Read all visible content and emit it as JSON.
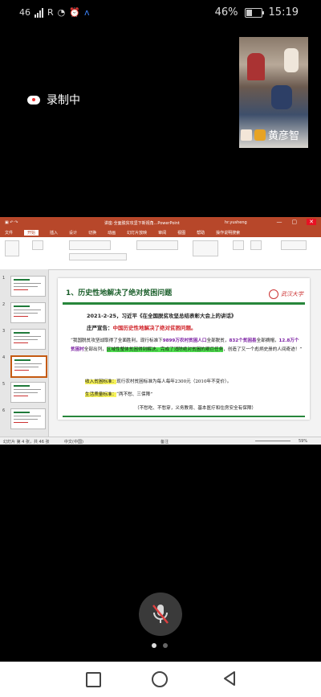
{
  "status_bar": {
    "network": "46",
    "signal2": "R",
    "battery": "46%",
    "battery_level": 0.46,
    "time": "15:19"
  },
  "recording": {
    "label": "录制中",
    "icon": "record-cloud-icon"
  },
  "participant": {
    "name": "黄彦智",
    "muted": true
  },
  "powerpoint": {
    "file_title": "讲座·全面脱贫攻坚下新视角...PowerPoint",
    "app": "PowerPoint",
    "user": "hr.yusheng",
    "tabs": [
      "文件",
      "开始",
      "插入",
      "设计",
      "切换",
      "动画",
      "幻灯片放映",
      "审阅",
      "视图",
      "帮助",
      "操作说明搜索"
    ],
    "active_tab": "开始",
    "slide_numbers": [
      "1",
      "2",
      "3",
      "4",
      "5",
      "6"
    ],
    "status_left": "幻灯片 第 4 张，共 46 张",
    "status_lang": "中文(中国)",
    "status_notes": "备注",
    "zoom": "59%"
  },
  "slide": {
    "heading": "1、历史性地解决了绝对贫困问题",
    "logo_text": "武汉大学",
    "date_line": "2021-2-25，习近平《在全国脱贫攻坚总结表彰大会上的讲话》",
    "declare_prefix": "庄严宣告：",
    "declare_red": "中国历史性地解决了绝对贫困问题。",
    "quote_1": "“我国脱贫攻坚战取得了全面胜利，现行标准下",
    "quote_purple_1": "9899万农村贫困人口",
    "quote_2": "全部脱贫，",
    "quote_purple_2": "832个贫困县",
    "quote_3": "全部摘帽，",
    "quote_purple_3": "12.8万个贫困村",
    "quote_4": "全部出列，",
    "quote_green": "区域性整体贫困得到解决，完成了消除绝对贫困的艰巨任务",
    "quote_5": "，创造了又一个彪炳史册的人间奇迹！”",
    "income_label": "收入贫困标准：",
    "income_text": "现行农村贫困标准为每人每年2300元（2010年不变价）。",
    "life_label": "生活质量标准：",
    "life_text": "“两不愁、三保障”",
    "guarantee_text": "（不愁吃、不愁穿，义务教育、基本医疗和住房安全有保障）"
  }
}
